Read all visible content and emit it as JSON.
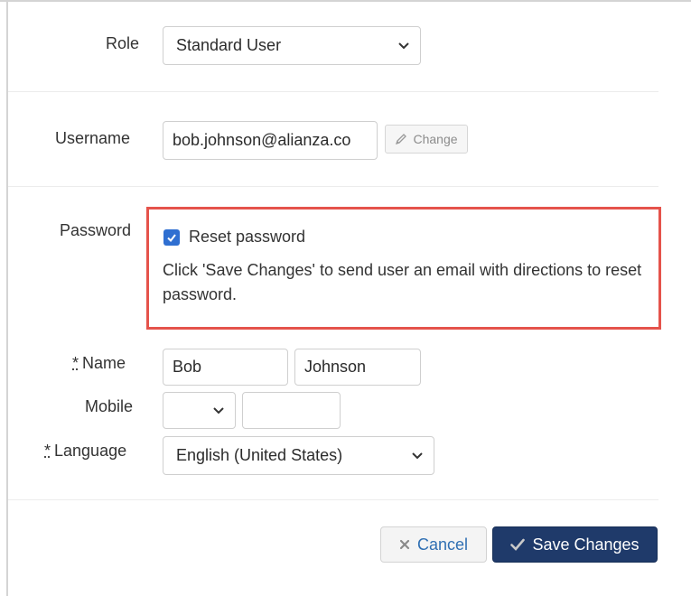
{
  "form": {
    "role": {
      "label": "Role",
      "selected": "Standard User"
    },
    "username": {
      "label": "Username",
      "value": "bob.johnson@alianza.co",
      "change_label": "Change"
    },
    "password": {
      "label": "Password",
      "reset_checked": true,
      "reset_label": "Reset password",
      "help_text": "Click 'Save Changes' to send user an email with directions to reset password."
    },
    "name": {
      "required_marker": "*",
      "label": "Name",
      "first": "Bob",
      "last": "Johnson"
    },
    "mobile": {
      "label": "Mobile",
      "country_code": "",
      "number": ""
    },
    "language": {
      "required_marker": "*",
      "label": "Language",
      "selected": "English (United States)"
    }
  },
  "actions": {
    "cancel_label": "Cancel",
    "save_label": "Save Changes"
  },
  "colors": {
    "primary": "#1f3a6a",
    "link": "#2f6fb3",
    "highlight_border": "#e5534b",
    "checkbox": "#2f6fd1"
  },
  "icons": {
    "chevron": "chevron-down-icon",
    "pencil": "pencil-icon",
    "cancel": "x-icon",
    "save": "checkmark-icon",
    "checkbox": "checkbox-checked-icon"
  }
}
